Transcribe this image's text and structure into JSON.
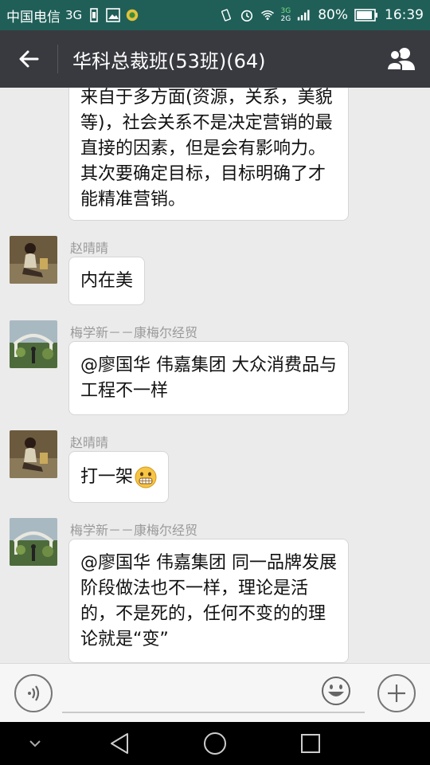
{
  "status_bar": {
    "carrier": "中国电信",
    "network": "3G",
    "network2_top": "3G",
    "network2_bottom": "2G",
    "battery": "80%",
    "time": "16:39"
  },
  "header": {
    "title": "华科总裁班(53班)(64)"
  },
  "messages": [
    {
      "sender": "",
      "text": "来自于多方面(资源，关系，美貌等)，社会关系不是决定营销的最直接的因素，但是会有影响力。其次要确定目标，目标明确了才能精准营销。",
      "avatar": "none"
    },
    {
      "sender": "赵晴晴",
      "text": "内在美",
      "avatar": "woman-sitting-photo"
    },
    {
      "sender": "梅学新－－康梅尔经贸",
      "text": "@廖国华 伟嘉集团 大众消费品与工程不一样",
      "avatar": "garden-photo"
    },
    {
      "sender": "赵晴晴",
      "text": "打一架",
      "emoji": "grimace-emoji",
      "avatar": "woman-sitting-photo"
    },
    {
      "sender": "梅学新－－康梅尔经贸",
      "text": "@廖国华 伟嘉集团 同一品牌发展阶段做法也不一样，理论是活的，不是死的，任何不变的的理论就是“变”",
      "avatar": "garden-photo"
    }
  ],
  "input": {
    "value": "",
    "placeholder": ""
  },
  "colors": {
    "status_bar_bg": "#1f5f58",
    "title_bar_bg": "#393a3f",
    "chat_bg": "#ebebeb",
    "bubble_bg": "#ffffff"
  }
}
